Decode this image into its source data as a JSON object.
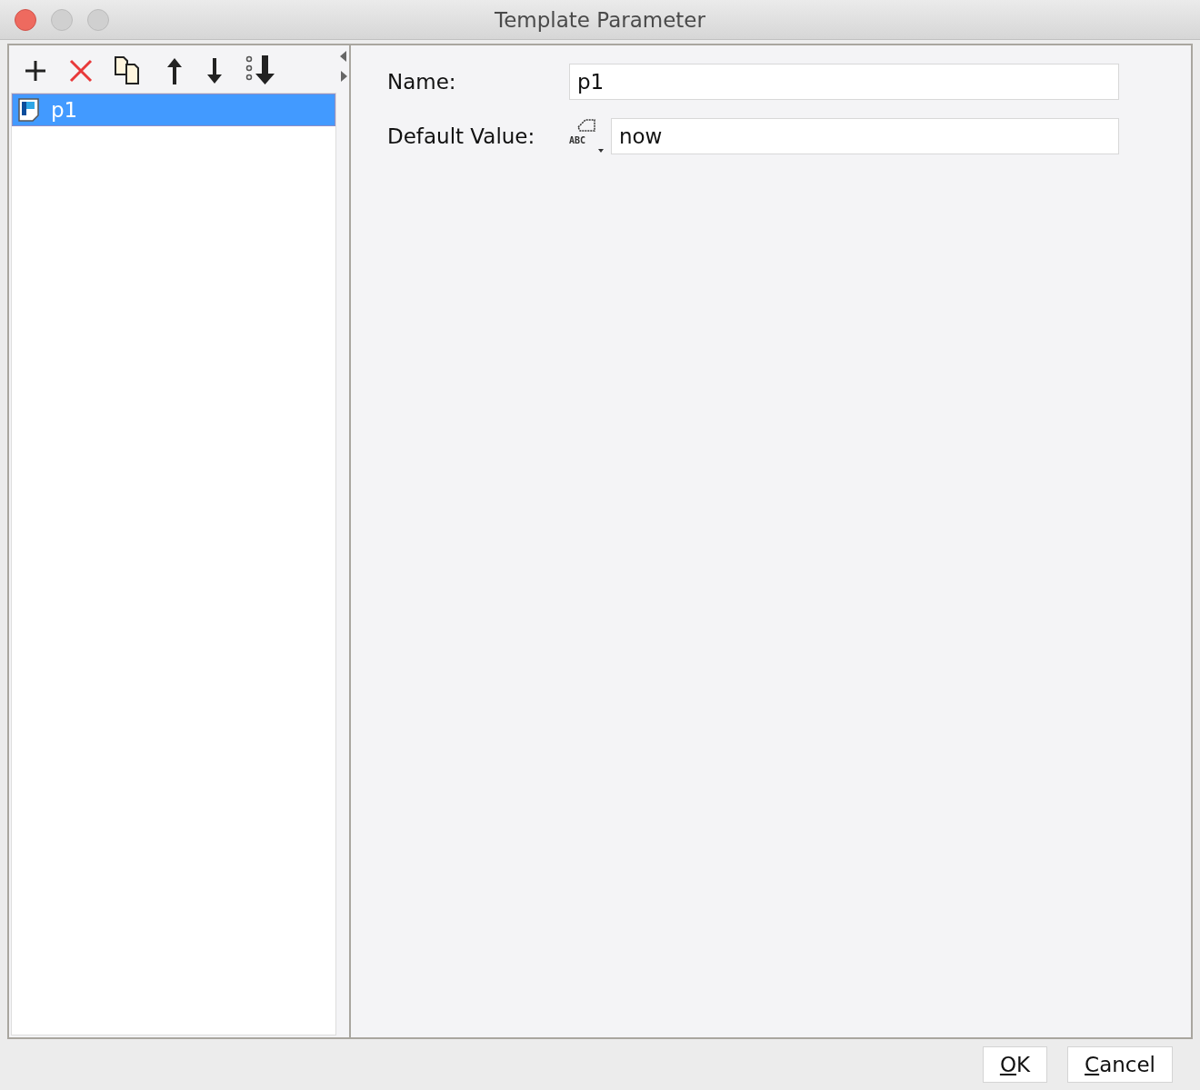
{
  "window": {
    "title": "Template Parameter"
  },
  "toolbar": [
    {
      "kind": "add"
    },
    {
      "kind": "delete"
    },
    {
      "kind": "copy"
    },
    {
      "kind": "up"
    },
    {
      "kind": "down"
    },
    {
      "kind": "sort"
    }
  ],
  "parameters": [
    {
      "name": "p1",
      "selected": true
    }
  ],
  "form": {
    "name_label": "Name:",
    "name_value": "p1",
    "default_label": "Default Value:",
    "type_icon_text": "ABC",
    "default_value": "now"
  },
  "buttons": [
    {
      "mnemonic": "O",
      "rest": "K"
    },
    {
      "mnemonic": "C",
      "rest": "ancel"
    }
  ]
}
